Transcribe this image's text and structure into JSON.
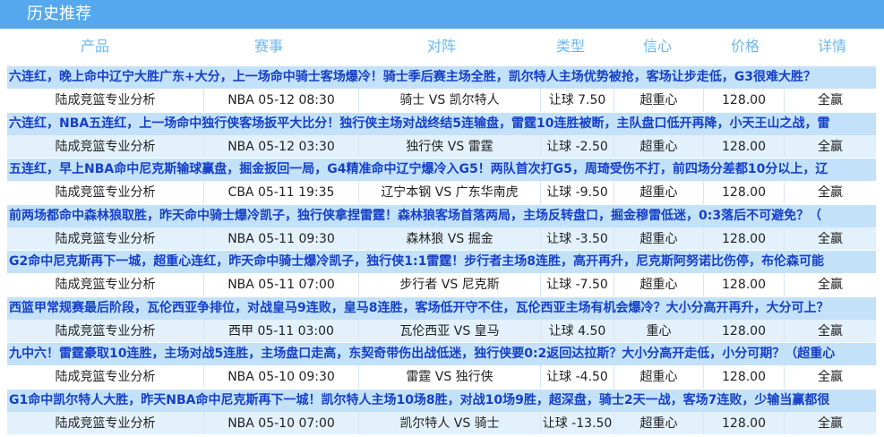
{
  "panel": {
    "title": "历史推荐"
  },
  "columns": {
    "product": "产品",
    "event": "赛事",
    "match": "对阵",
    "type": "类型",
    "confidence": "信心",
    "price": "价格",
    "detail": "详情"
  },
  "records": [
    {
      "text": "六连红，晚上命中辽宁大胜广东+大分，上一场命中骑士客场爆冷！骑士季后赛主场全胜，凯尔特人主场优势被抢，客场让步走低，G3很难大胜？",
      "product": "陆成竞篮专业分析",
      "event": "NBA 05-12 08:30",
      "match": "骑士 VS 凯尔特人",
      "type": "让球 7.50",
      "confidence": "超重心",
      "price": "128.00",
      "detail": "全赢"
    },
    {
      "text": "六连红，NBA五连红，上一场命中独行侠客场扳平大比分！独行侠主场对战终结5连输盘，雷霆10连胜被断，主队盘口低开再降，小天王山之战，雷",
      "product": "陆成竞篮专业分析",
      "event": "NBA 05-12 03:30",
      "match": "独行侠 VS 雷霆",
      "type": "让球 -2.50",
      "confidence": "超重心",
      "price": "128.00",
      "detail": "全赢"
    },
    {
      "text": "五连红，早上NBA命中尼克斯输球赢盘，掘金扳回一局，G4精准命中辽宁爆冷入G5！两队首次打G5，周琦受伤不打，前四场分差都10分以上，辽",
      "product": "陆成竞篮专业分析",
      "event": "CBA 05-11 19:35",
      "match": "辽宁本钢 VS 广东华南虎",
      "type": "让球 -9.50",
      "confidence": "超重心",
      "price": "128.00",
      "detail": "全赢"
    },
    {
      "text": "前两场都命中森林狼取胜，昨天命中骑士爆冷凯子，独行侠拿捏雷霆！森林狼客场首落两局，主场反转盘口，掘金穆雷低迷，0:3落后不可避免？（",
      "product": "陆成竞篮专业分析",
      "event": "NBA 05-11 09:30",
      "match": "森林狼 VS 掘金",
      "type": "让球 -3.50",
      "confidence": "超重心",
      "price": "128.00",
      "detail": "全赢"
    },
    {
      "text": "G2命中尼克斯再下一城，超重心连红，昨天命中骑士爆冷凯子，独行侠1:1雷霆！步行者主场8连胜，高开再升，尼克斯阿努诺比伤停，布伦森可能",
      "product": "陆成竞篮专业分析",
      "event": "NBA 05-11 07:00",
      "match": "步行者 VS 尼克斯",
      "type": "让球 -7.50",
      "confidence": "超重心",
      "price": "128.00",
      "detail": "全赢"
    },
    {
      "text": "西篮甲常规赛最后阶段，瓦伦西亚争排位，对战皇马9连败，皇马8连胜，客场低开守不住，瓦伦西亚主场有机会爆冷？大小分高开再升，大分可上？",
      "product": "陆成竞篮专业分析",
      "event": "西甲 05-11 03:00",
      "match": "瓦伦西亚 VS 皇马",
      "type": "让球 4.50",
      "confidence": "重心",
      "price": "128.00",
      "detail": "全赢"
    },
    {
      "text": "九中六！雷霆豪取10连胜，主场对战5连胜，主场盘口走高，东契奇带伤出战低迷，独行侠要0:2返回达拉斯？大小分高开走低，小分可期？（超重心",
      "product": "陆成竞篮专业分析",
      "event": "NBA 05-10 09:30",
      "match": "雷霆 VS 独行侠",
      "type": "让球 -4.50",
      "confidence": "超重心",
      "price": "128.00",
      "detail": "全赢"
    },
    {
      "text": "G1命中凯尔特人大胜，昨天NBA命中尼克斯再下一城！凯尔特人主场10场8胜，对战10场9胜，超深盘，骑士2天一战，客场7连败，少输当赢都很",
      "product": "陆成竞篮专业分析",
      "event": "NBA 05-10 07:00",
      "match": "凯尔特人 VS 骑士",
      "type": "让球 -13.50",
      "confidence": "超重心",
      "price": "128.00",
      "detail": "全赢"
    }
  ]
}
